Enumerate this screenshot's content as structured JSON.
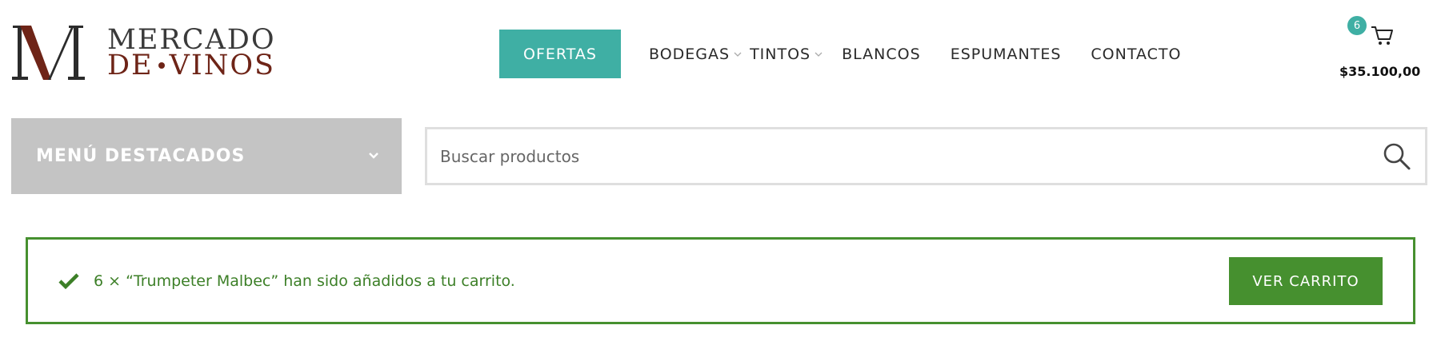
{
  "brand": {
    "logo_letter": "M",
    "name_line1": "MERCADO",
    "name_line2_a": "DE",
    "name_line2_b": "VINOS",
    "colors": {
      "dark": "#2b2b2b",
      "wine": "#6e2417"
    }
  },
  "nav": {
    "items": [
      {
        "label": "OFERTAS",
        "highlighted": true,
        "has_dropdown": false
      },
      {
        "label": "BODEGAS",
        "highlighted": false,
        "has_dropdown": true
      },
      {
        "label": "TINTOS",
        "highlighted": false,
        "has_dropdown": true
      },
      {
        "label": "BLANCOS",
        "highlighted": false,
        "has_dropdown": false
      },
      {
        "label": "ESPUMANTES",
        "highlighted": false,
        "has_dropdown": false
      },
      {
        "label": "CONTACTO",
        "highlighted": false,
        "has_dropdown": false
      }
    ],
    "accent_color": "#3fafa4"
  },
  "cart": {
    "count": "6",
    "total": "$35.100,00",
    "icon": "cart-icon"
  },
  "featured_menu": {
    "label": "MENÚ DESTACADOS",
    "icon": "chevron-down-icon",
    "background": "#c4c4c4"
  },
  "search": {
    "placeholder": "Buscar productos",
    "value": "",
    "icon": "search-icon"
  },
  "notice": {
    "message": "6 × “Trumpeter Malbec” han sido añadidos a tu carrito.",
    "button_label": "VER CARRITO",
    "icon": "check-icon",
    "color": "#46902f"
  }
}
